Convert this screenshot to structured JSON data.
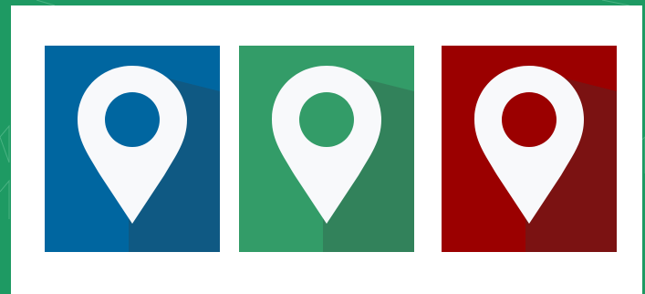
{
  "colors": {
    "frame": "#1e9a63",
    "canvas": "#ffffff",
    "pin": "#f8f9fb"
  },
  "tiles": [
    {
      "icon": "location-pin-icon",
      "background": "#0066a0",
      "shadow": "#0f5983"
    },
    {
      "icon": "location-pin-icon",
      "background": "#339c68",
      "shadow": "#32825b"
    },
    {
      "icon": "location-pin-icon",
      "background": "#9b0000",
      "shadow": "#7b1212"
    }
  ]
}
